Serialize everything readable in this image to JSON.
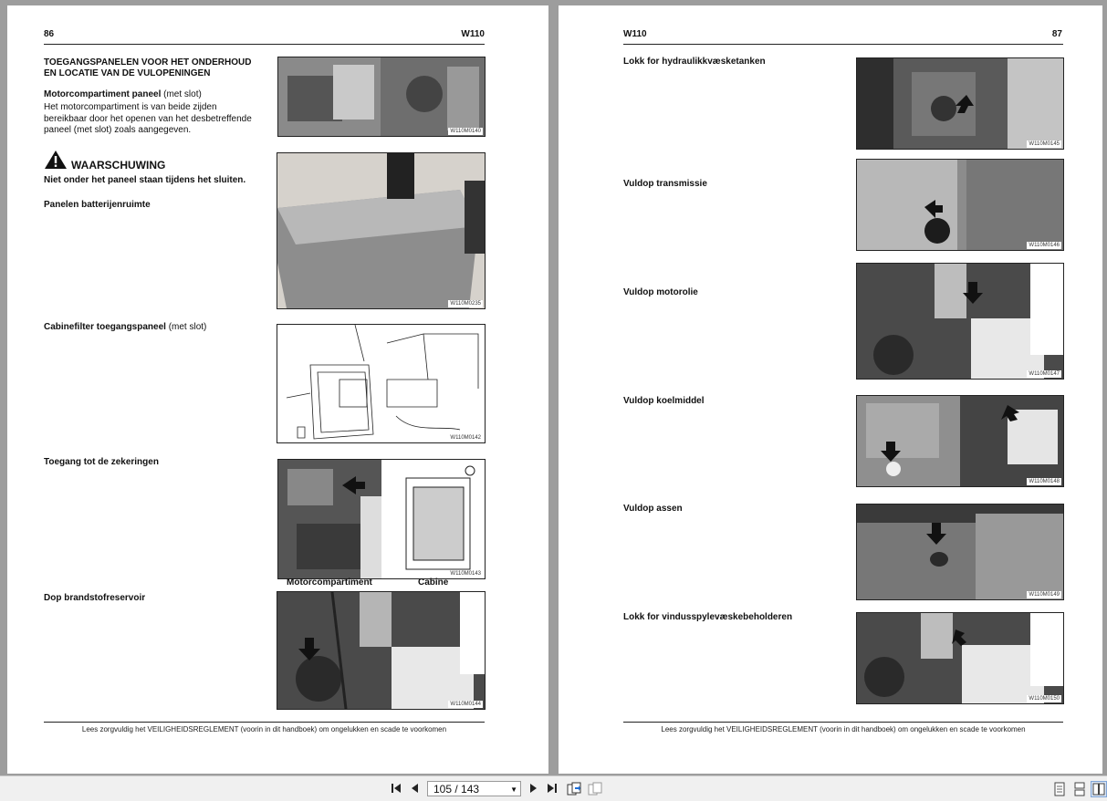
{
  "left_page": {
    "page_number": "86",
    "model": "W110",
    "title": "TOEGANGSPANELEN VOOR HET ONDERHOUD EN LOCATIE VAN DE VULOPENINGEN",
    "engine_panel_label": "Motorcompartiment paneel",
    "engine_panel_suffix": "(met slot)",
    "engine_panel_text": "Het motorcompartiment is van beide zijden bereikbaar door het openen van het desbetreffende paneel (met slot) zoals aangegeven.",
    "warning_title": "WAARSCHUWING",
    "warning_text": "Niet onder het paneel staan tijdens het sluiten.",
    "battery_panels": "Panelen batterijenruimte",
    "cabin_filter_label": "Cabinefilter toegangspaneel",
    "cabin_filter_suffix": "(met slot)",
    "fuses": "Toegang tot de zekeringen",
    "caption_engine": "Motorcompartiment",
    "caption_cabin": "Cabine",
    "fuel_cap": "Dop brandstofreservoir",
    "codes": [
      "W110M0140",
      "W110M0235",
      "W110M0142",
      "W110M0143",
      "W110M0144"
    ],
    "footer": "Lees zorgvuldig het VEILIGHEIDSREGLEMENT (voorin in dit handboek) om ongelukken en scade te voorkomen"
  },
  "right_page": {
    "page_number": "87",
    "model": "W110",
    "items": [
      {
        "label": "Lokk for hydraulikkvæsketanken",
        "code": "W110M0145"
      },
      {
        "label": "Vuldop transmissie",
        "code": "W110M0146"
      },
      {
        "label": "Vuldop motorolie",
        "code": "W110M0147"
      },
      {
        "label": "Vuldop koelmiddel",
        "code": "W110M0148"
      },
      {
        "label": "Vuldop assen",
        "code": "W110M0149"
      },
      {
        "label": "Lokk for vindusspylevæskebeholderen",
        "code": "W110M0150"
      }
    ],
    "footer": "Lees zorgvuldig het VEILIGHEIDSREGLEMENT (voorin in dit handboek) om ongelukken en scade te voorkomen"
  },
  "toolbar": {
    "page_indicator": "105 / 143",
    "first_icon": "first-page-icon",
    "prev_icon": "prev-page-icon",
    "next_icon": "next-page-icon",
    "last_icon": "last-page-icon"
  }
}
